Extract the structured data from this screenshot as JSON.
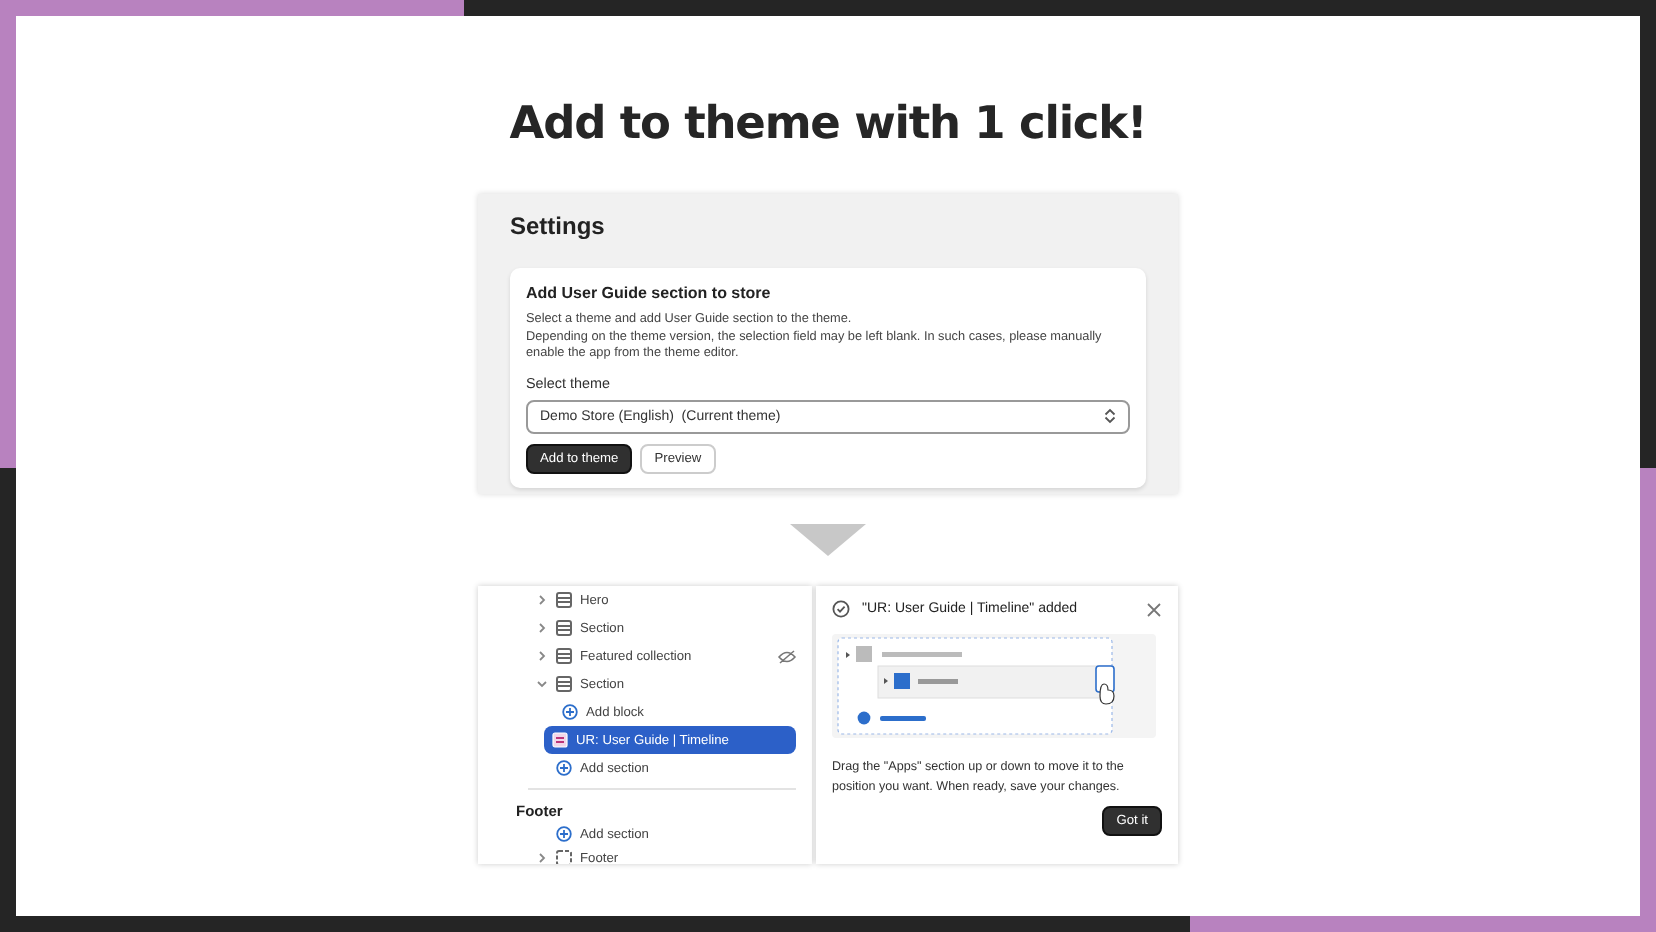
{
  "headline": "Add to theme with 1 click!",
  "settings": {
    "title": "Settings",
    "card": {
      "title": "Add User Guide section to store",
      "description": [
        "Select a theme and add User Guide section to the theme.",
        "Depending on the theme version, the selection field may be left blank. In such cases, please manually enable the app from the theme editor."
      ],
      "select_label": "Select theme",
      "select_value": "Demo Store (English)  (Current theme)",
      "buttons": [
        {
          "label": "Add to theme",
          "kind": "primary"
        },
        {
          "label": "Preview",
          "kind": "secondary"
        }
      ]
    }
  },
  "editor": {
    "tree": [
      {
        "kind": "section",
        "label": "Hero",
        "expanded": false,
        "hidden": false,
        "selected": false
      },
      {
        "kind": "section",
        "label": "Section",
        "expanded": false,
        "hidden": false,
        "selected": false
      },
      {
        "kind": "section",
        "label": "Featured collection",
        "expanded": false,
        "hidden": true,
        "selected": false
      },
      {
        "kind": "section",
        "label": "Section",
        "expanded": true,
        "hidden": false,
        "selected": false,
        "children": [
          {
            "kind": "add",
            "label": "Add block",
            "selected": false
          },
          {
            "kind": "app",
            "label": "UR: User Guide | Timeline",
            "selected": true
          }
        ]
      },
      {
        "kind": "add",
        "label": "Add section",
        "selected": false
      }
    ],
    "footer": {
      "heading": "Footer",
      "items": [
        {
          "kind": "add",
          "label": "Add section",
          "selected": false
        },
        {
          "kind": "section",
          "label": "Footer",
          "expanded": false,
          "hidden": false,
          "selected": false
        }
      ]
    }
  },
  "popup": {
    "title": "\"UR: User Guide | Timeline\" added",
    "text": "Drag the \"Apps\" section up or down to move it to the position you want. When ready, save your changes.",
    "button": "Got it"
  }
}
